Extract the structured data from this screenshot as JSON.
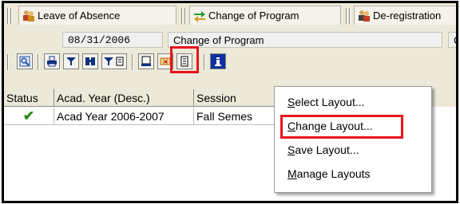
{
  "tabs": [
    {
      "label": "Leave of Absence",
      "icon": "people-icon"
    },
    {
      "label": "Change of Program",
      "icon": "arrows-icon"
    },
    {
      "label": "De-registration",
      "icon": "people-remove-icon"
    }
  ],
  "info": {
    "date": "08/31/2006",
    "description": "Change of Program",
    "trailing_char": "C"
  },
  "toolbar": {
    "buttons": [
      "details-icon",
      "print-icon",
      "filter-icon",
      "find-icon",
      "set-filter-icon",
      "local-file-icon",
      "spreadsheet-icon",
      "layout-icon",
      "info-icon"
    ],
    "highlight_color": "#e8141c"
  },
  "table": {
    "headers": [
      "Status",
      "Acad. Year (Desc.)",
      "Session"
    ],
    "rows": [
      {
        "status_icon": "checkmark-icon",
        "acad_year": "Acad Year 2006-2007",
        "session": "Fall Semes"
      }
    ]
  },
  "menu": {
    "items": [
      {
        "first": "S",
        "rest": "elect Layout..."
      },
      {
        "first": "C",
        "rest": "hange Layout..."
      },
      {
        "first": "S",
        "rest": "ave Layout..."
      },
      {
        "first": "M",
        "rest": "anage Layouts"
      }
    ],
    "highlighted_index": 1
  }
}
